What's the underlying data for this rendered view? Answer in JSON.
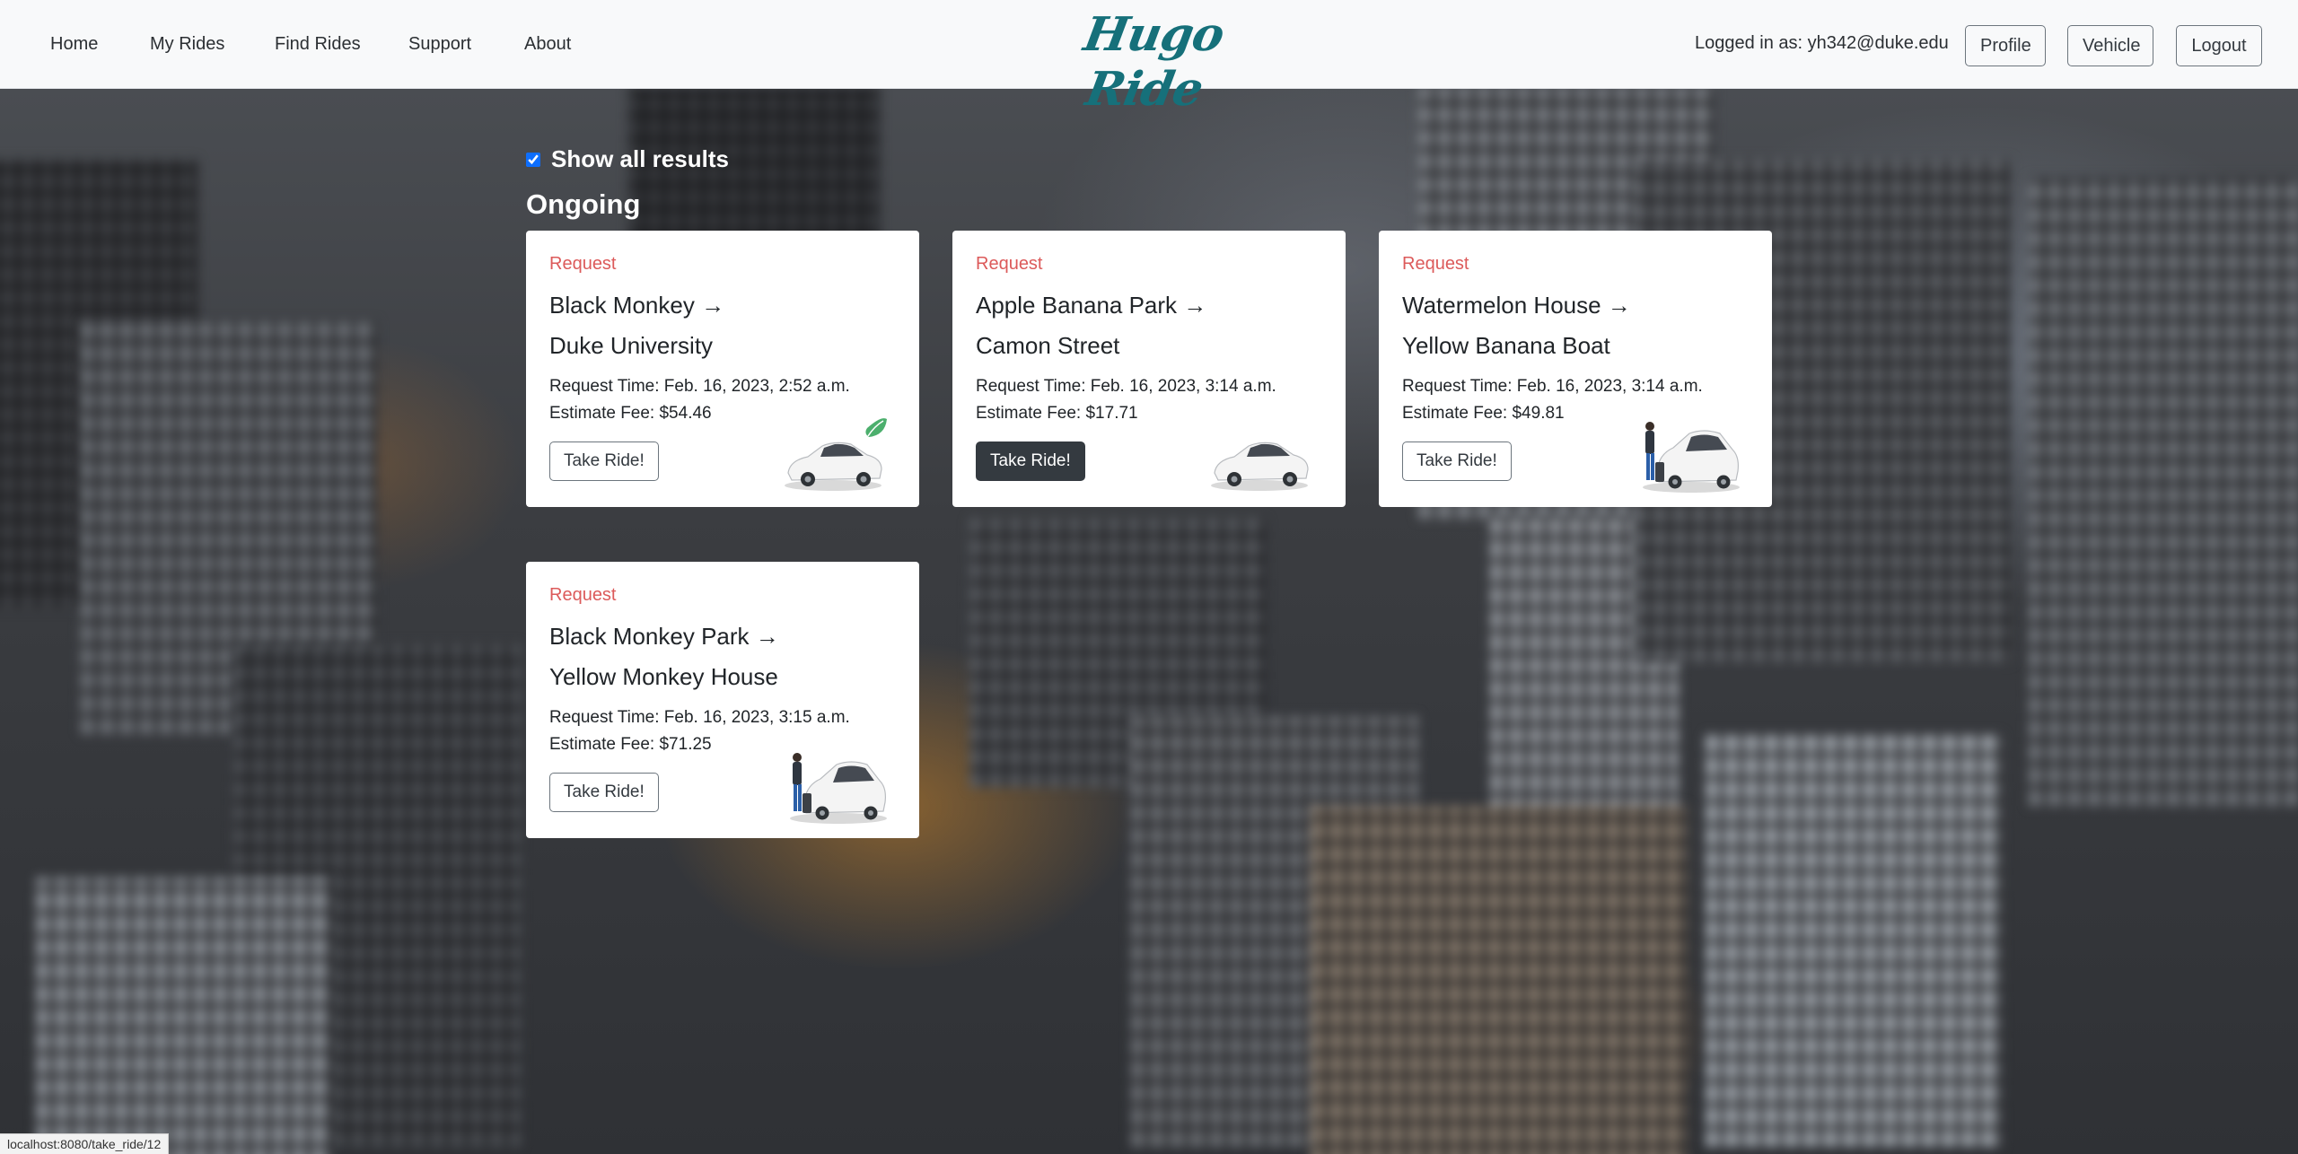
{
  "nav": {
    "links": [
      "Home",
      "My Rides",
      "Find Rides",
      "Support",
      "About"
    ],
    "brand": "Hugo Ride",
    "logged_in": "Logged in as: yh342@duke.edu",
    "buttons": [
      "Profile",
      "Vehicle",
      "Logout"
    ]
  },
  "filter": {
    "show_all_label": "Show all results",
    "show_all_checked": true
  },
  "section": {
    "title": "Ongoing"
  },
  "rides": [
    {
      "status": "Request",
      "from": "Black Monkey →",
      "to": "Duke University",
      "request_time": "Request Time: Feb. 16, 2023, 2:52 a.m.",
      "fee": "Estimate Fee: $54.46",
      "button": "Take Ride!",
      "image": "eco-car-icon"
    },
    {
      "status": "Request",
      "from": "Apple Banana Park →",
      "to": "Camon Street",
      "request_time": "Request Time: Feb. 16, 2023, 3:14 a.m.",
      "fee": "Estimate Fee: $17.71",
      "button": "Take Ride!",
      "image": "car-icon"
    },
    {
      "status": "Request",
      "from": "Watermelon House →",
      "to": "Yellow Banana Boat",
      "request_time": "Request Time: Feb. 16, 2023, 3:14 a.m.",
      "fee": "Estimate Fee: $49.81",
      "button": "Take Ride!",
      "image": "van-with-passenger-icon"
    },
    {
      "status": "Request",
      "from": "Black Monkey Park →",
      "to": "Yellow Monkey House",
      "request_time": "Request Time: Feb. 16, 2023, 3:15 a.m.",
      "fee": "Estimate Fee: $71.25",
      "button": "Take Ride!",
      "image": "van-with-passenger-icon"
    }
  ],
  "statusbar": {
    "url": "localhost:8080/take_ride/12"
  },
  "colors": {
    "brand": "#16707a",
    "status": "#dc5a5a",
    "dark_button": "#343a40",
    "checkbox": "#0d6efd"
  }
}
